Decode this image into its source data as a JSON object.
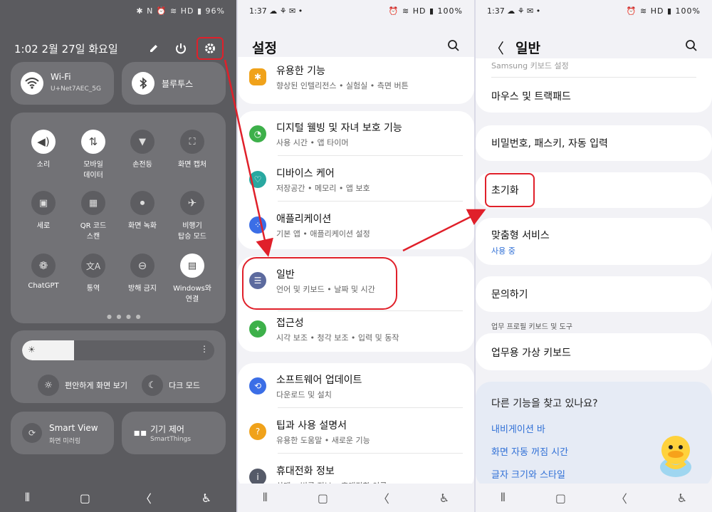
{
  "colors": {
    "accent_red": "#e0202a",
    "link_blue": "#2f6fd6"
  },
  "quick_panel": {
    "status": {
      "icons": "✱ N ⏰ ≋ HD ▮ 96%"
    },
    "header": {
      "datetime": "1:02  2월 27일 화요일",
      "edit_icon": "pencil-icon",
      "power_icon": "power-icon",
      "settings_icon": "gear-icon"
    },
    "wifi": {
      "label": "Wi-Fi",
      "network": "U+Net7AEC_5G"
    },
    "bluetooth": {
      "label": "블루투스"
    },
    "tiles": [
      {
        "label": "소리",
        "icon": "speaker-icon"
      },
      {
        "label": "모바일\n데이터",
        "icon": "data-icon"
      },
      {
        "label": "손전등",
        "icon": "flashlight-icon"
      },
      {
        "label": "화면 캡처",
        "icon": "capture-icon"
      },
      {
        "label": "세로",
        "icon": "lock-rotate-icon"
      },
      {
        "label": "QR 코드\n스캔",
        "icon": "qr-icon"
      },
      {
        "label": "화면 녹화",
        "icon": "record-icon"
      },
      {
        "label": "비행기\n탑승 모드",
        "icon": "airplane-icon"
      },
      {
        "label": "ChatGPT",
        "icon": "chatgpt-icon"
      },
      {
        "label": "통역",
        "icon": "translate-icon"
      },
      {
        "label": "방해 금지",
        "icon": "dnd-icon"
      },
      {
        "label": "Windows와\n연결",
        "icon": "windows-link-icon"
      }
    ],
    "brightness": {
      "level": 0.27,
      "comfort_label": "편안하게 화면 보기",
      "dark_label": "다크 모드"
    },
    "smart_view": {
      "label": "Smart View",
      "sub": "화면 미러링"
    },
    "device_control": {
      "label": "기기 제어",
      "sub": "SmartThings"
    }
  },
  "settings_panel": {
    "status": {
      "time": "1:37",
      "left_icons": "☁ ⚘ ✉ •",
      "icons": "⏰ ≋ HD ▮ 100%"
    },
    "title": "설정",
    "items": [
      {
        "title": "유용한 기능",
        "sub": "향상된 인텔리전스 • 실험실 • 측면 버튼",
        "color": "#f0a21a",
        "icon": "star-gear-icon"
      },
      {
        "title": "디지털 웰빙 및 자녀 보호 기능",
        "sub": "사용 시간 • 앱 타이머",
        "color": "#3db04a",
        "icon": "wellbeing-icon"
      },
      {
        "title": "디바이스 케어",
        "sub": "저장공간 • 메모리 • 앱 보호",
        "color": "#29a8a0",
        "icon": "device-care-icon"
      },
      {
        "title": "애플리케이션",
        "sub": "기본 앱 • 애플리케이션 설정",
        "color": "#3b6ee6",
        "icon": "apps-icon"
      },
      {
        "title": "일반",
        "sub": "언어 및 키보드 • 날짜 및 시간",
        "color": "#5c6a9e",
        "icon": "sliders-icon"
      },
      {
        "title": "접근성",
        "sub": "시각 보조 • 청각 보조 • 입력 및 동작",
        "color": "#3db04a",
        "icon": "accessibility-icon"
      },
      {
        "title": "소프트웨어 업데이트",
        "sub": "다운로드 및 설치",
        "color": "#3b6ee6",
        "icon": "update-icon"
      },
      {
        "title": "팁과 사용 설명서",
        "sub": "유용한 도움말 • 새로운 기능",
        "color": "#f0a21a",
        "icon": "tips-icon"
      },
      {
        "title": "휴대전화 정보",
        "sub": "상태 • 법률 정보 • 휴대전화 이름",
        "color": "#555a68",
        "icon": "info-icon"
      }
    ]
  },
  "general_panel": {
    "status": {
      "time": "1:37",
      "left_icons": "☁ ⚘ ✉ •",
      "icons": "⏰ ≋ HD ▮ 100%"
    },
    "title": "일반",
    "top_partial": "Samsung 키보드 설정",
    "items": [
      {
        "title": "마우스 및 트랙패드"
      },
      {
        "title": "비밀번호, 패스키, 자동 입력"
      },
      {
        "title": "초기화"
      },
      {
        "title": "맞춤형 서비스",
        "sub": "사용 중"
      },
      {
        "title": "문의하기"
      }
    ],
    "section_label": "업무 프로필 키보드 및 도구",
    "work_keyboard": "업무용 가상 키보드",
    "more": {
      "title": "다른 기능을 찾고 있나요?",
      "links": [
        "내비게이션 바",
        "화면 자동 꺼짐 시간",
        "글자 크기와 스타일"
      ]
    }
  }
}
